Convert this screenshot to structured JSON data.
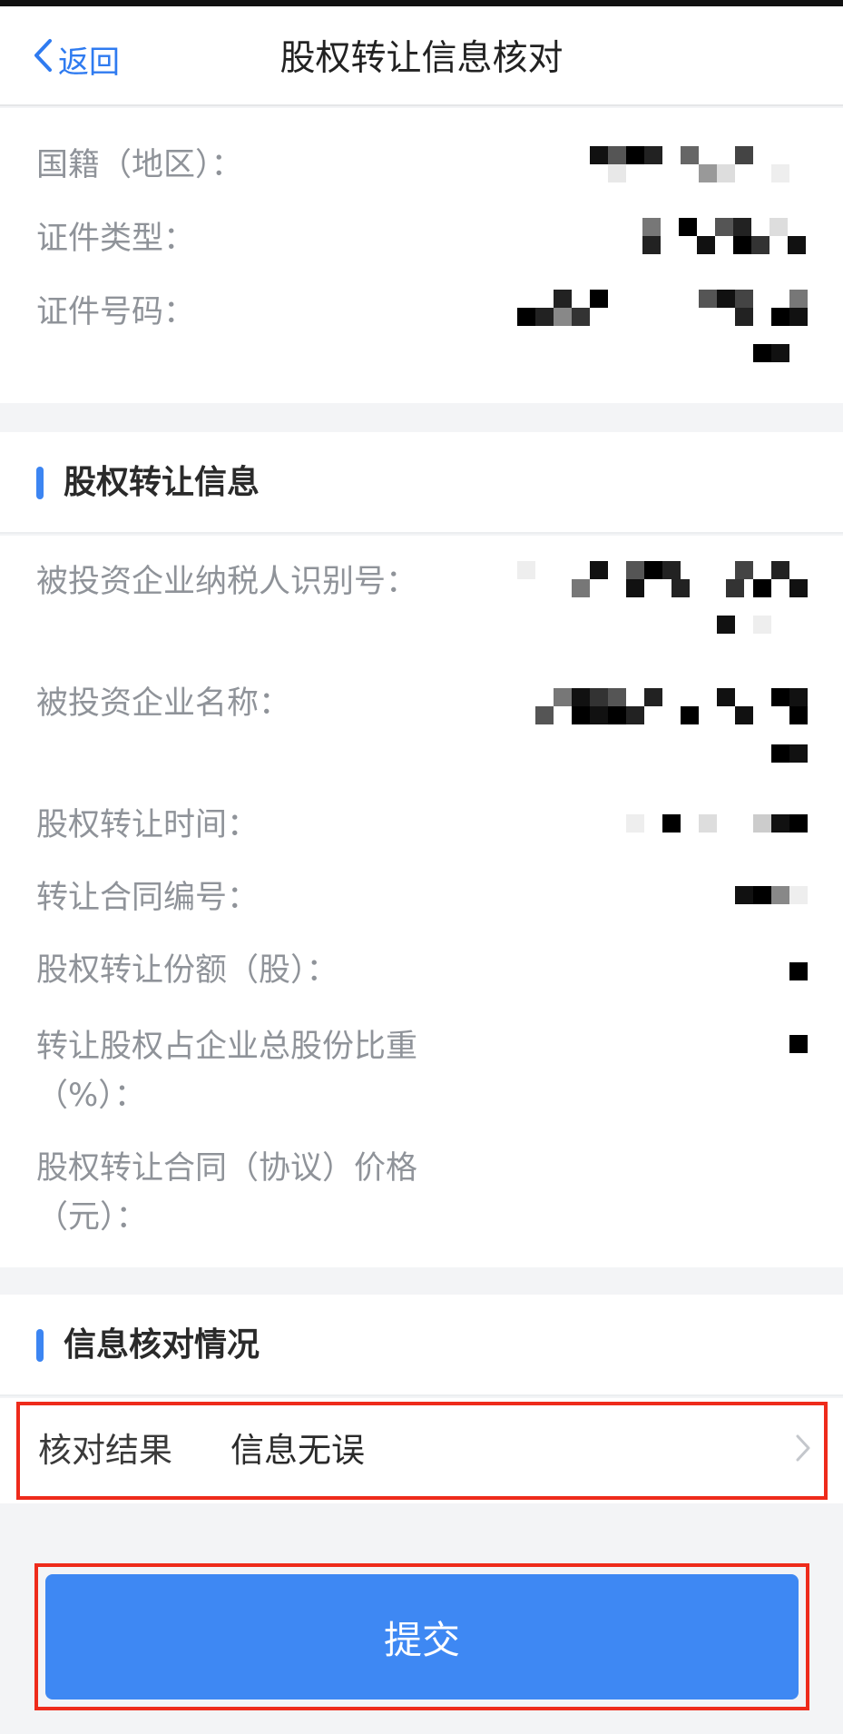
{
  "nav": {
    "back_label": "返回",
    "title": "股权转让信息核对"
  },
  "personal": {
    "nationality_label": "国籍（地区）：",
    "id_type_label": "证件类型：",
    "id_number_label": "证件号码："
  },
  "transfer": {
    "section_title": "股权转让信息",
    "fields": [
      {
        "label": "被投资企业纳税人识别号："
      },
      {
        "label": "被投资企业名称："
      },
      {
        "label": "股权转让时间："
      },
      {
        "label": "转让合同编号："
      },
      {
        "label": "股权转让份额（股）："
      },
      {
        "label_line1": "转让股权占企业总股份比重",
        "label_line2": "（%）："
      },
      {
        "label_line1": "股权转让合同（协议）价格",
        "label_line2": "（元）："
      }
    ]
  },
  "verification": {
    "section_title": "信息核对情况",
    "result_label": "核对结果",
    "result_value": "信息无误"
  },
  "submit": {
    "label": "提交"
  },
  "colors": {
    "accent": "#3e88f3",
    "highlight_border": "#ee2b1b",
    "label_gray": "#8f9399"
  }
}
